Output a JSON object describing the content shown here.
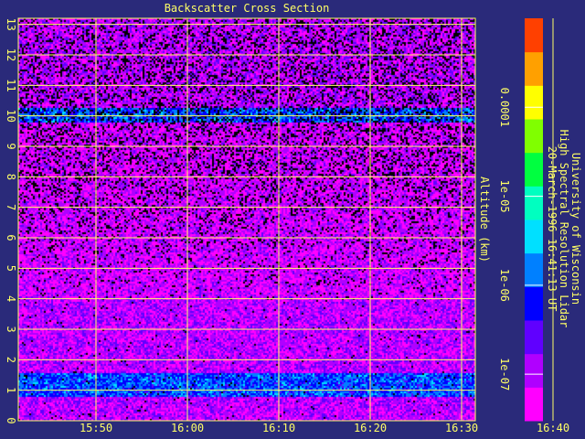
{
  "chart_data": {
    "type": "heatmap",
    "title": "Backscatter Cross Section",
    "ylabel": "Altitude (km)",
    "x_ticks": [
      "15:50",
      "16:00",
      "16:10",
      "16:20",
      "16:30",
      "16:40"
    ],
    "x_range_minutes": [
      -8.5,
      41.5
    ],
    "x_tick_minutes": [
      0,
      10,
      20,
      30,
      40,
      50
    ],
    "y_ticks": [
      "0",
      "1",
      "2",
      "3",
      "4",
      "5",
      "6",
      "7",
      "8",
      "9",
      "10",
      "11",
      "12",
      "13"
    ],
    "ylim": [
      0,
      13.2
    ],
    "grid": true,
    "colorbar": {
      "scale": "log",
      "range": [
        3e-08,
        0.001
      ],
      "tick_labels": [
        "0.0001",
        "1e-05",
        "1e-06",
        "1e-07"
      ],
      "tick_values": [
        0.0001,
        1e-05,
        1e-06,
        1e-07
      ],
      "colors": [
        "#ff00ff",
        "#b000ff",
        "#6000ff",
        "#0000ff",
        "#0080ff",
        "#00e0ff",
        "#00ffc0",
        "#00ff40",
        "#80ff00",
        "#ffff00",
        "#ffa000",
        "#ff4000"
      ]
    },
    "layers": [
      {
        "altitude_range_km": [
          0,
          0.8
        ],
        "level": "1e-07"
      },
      {
        "altitude_range_km": [
          0.8,
          1.6
        ],
        "level": "1e-06"
      },
      {
        "altitude_range_km": [
          1.6,
          4.0
        ],
        "level": "1e-07"
      },
      {
        "altitude_range_km": [
          9.8,
          10.3
        ],
        "level": "1e-06"
      },
      {
        "altitude_range_km": [
          10.3,
          13.2
        ],
        "level": "1e-07"
      }
    ],
    "caption_lines": [
      "University of Wisconsin",
      "High Spectral Resolution Lidar",
      "20-March-1996 16:41:13 UT"
    ],
    "colors": {
      "background": "#2a2a7a",
      "text": "#ffff66",
      "grid": "#ffff66"
    }
  }
}
